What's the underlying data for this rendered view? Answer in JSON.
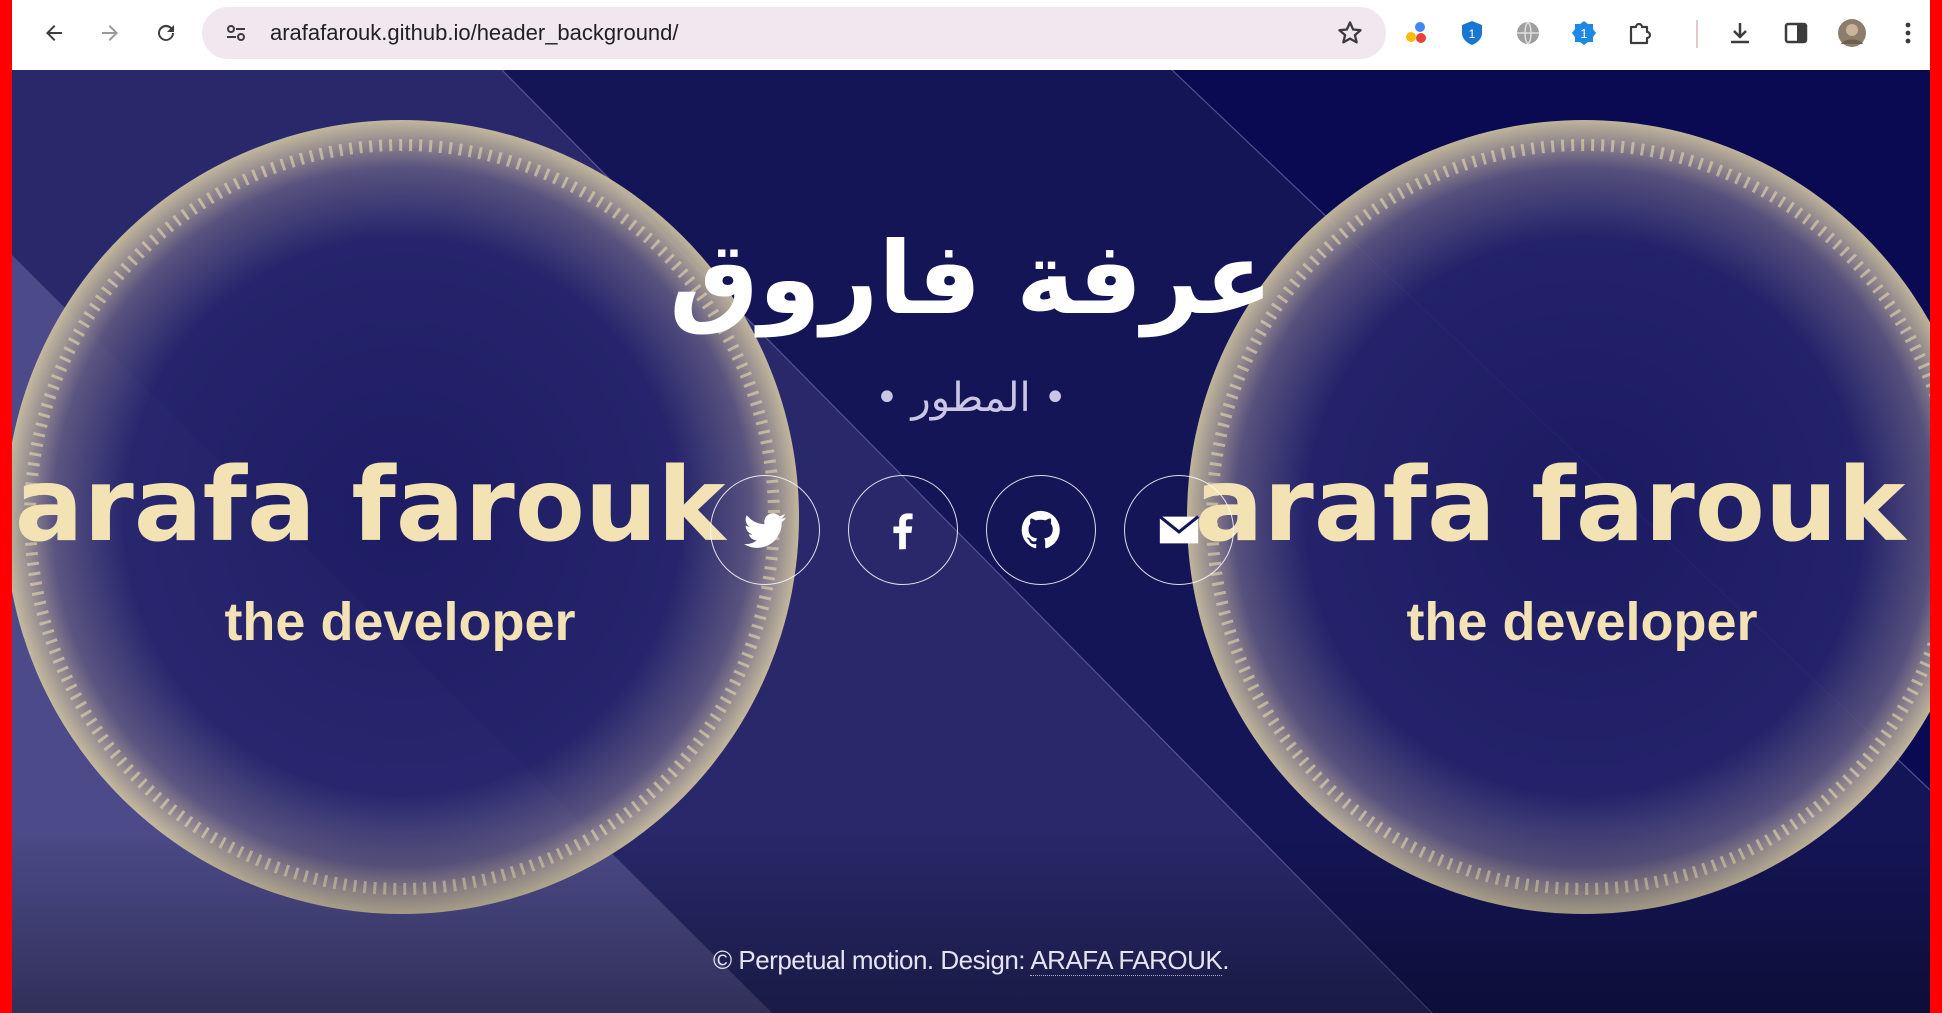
{
  "browser": {
    "url": "arafafarouk.github.io/header_background/",
    "extensions": [
      "extension-multicolor-icon",
      "bitwarden-shield-icon",
      "globe-icon",
      "badge-1-icon",
      "puzzle-icon"
    ],
    "extension_badge": "1",
    "shield_badge": "1"
  },
  "hero": {
    "title": "عرفة فاروق",
    "subtitle": "• المطور •",
    "logo_name": "arafa farouk",
    "logo_tagline": "the developer",
    "social": [
      {
        "name": "twitter-icon"
      },
      {
        "name": "facebook-icon"
      },
      {
        "name": "github-icon"
      },
      {
        "name": "email-icon"
      }
    ]
  },
  "footer": {
    "text": "© Perpetual motion. Design: ",
    "link": "ARAFA FAROUK",
    "end": "."
  },
  "colors": {
    "background": "#141556",
    "accent_gold": "#f3e2b4",
    "frame": "#ff0000"
  }
}
